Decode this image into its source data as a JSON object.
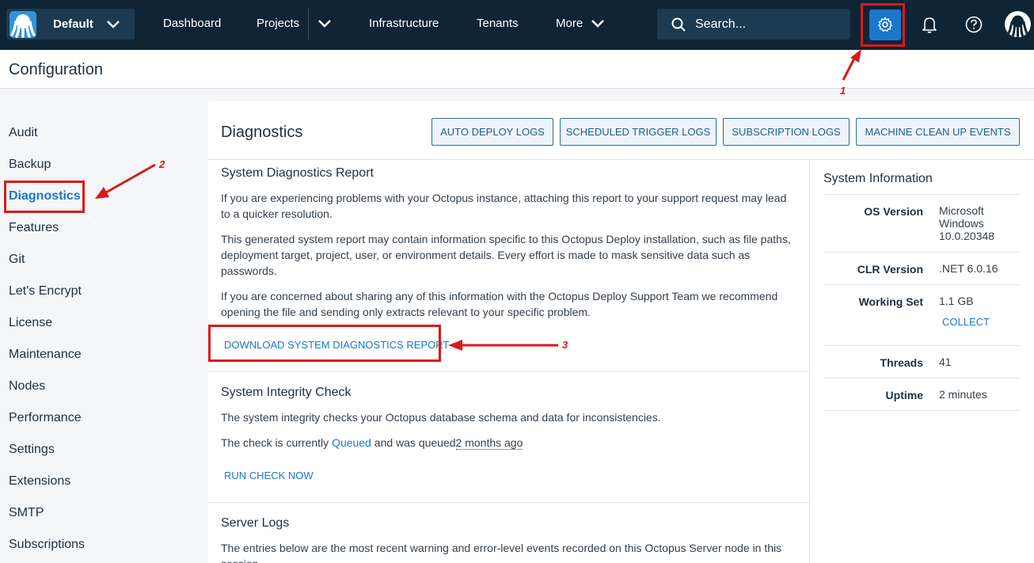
{
  "topnav": {
    "space_name": "Default",
    "links": [
      "Dashboard",
      "Projects",
      "Infrastructure",
      "Tenants",
      "More"
    ],
    "search_placeholder": "Search..."
  },
  "page": {
    "title": "Configuration"
  },
  "sidebar": {
    "items": [
      "Audit",
      "Backup",
      "Diagnostics",
      "Features",
      "Git",
      "Let's Encrypt",
      "License",
      "Maintenance",
      "Nodes",
      "Performance",
      "Settings",
      "Extensions",
      "SMTP",
      "Subscriptions"
    ],
    "active": "Diagnostics"
  },
  "main": {
    "title": "Diagnostics",
    "toolbar": [
      "AUTO DEPLOY LOGS",
      "SCHEDULED TRIGGER LOGS",
      "SUBSCRIPTION LOGS",
      "MACHINE CLEAN UP EVENTS"
    ],
    "report": {
      "title": "System Diagnostics Report",
      "p1": "If you are experiencing problems with your Octopus instance, attaching this report to your support request may lead to a quicker resolution.",
      "p2": "This generated system report may contain information specific to this Octopus Deploy installation, such as file paths, deployment target, project, user, or environment details. Every effort is made to mask sensitive data such as passwords.",
      "p3": "If you are concerned about sharing any of this information with the Octopus Deploy Support Team we recommend opening the file and sending only extracts relevant to your specific problem.",
      "download_label": "DOWNLOAD SYSTEM DIAGNOSTICS REPORT"
    },
    "integrity": {
      "title": "System Integrity Check",
      "p1": "The system integrity checks your Octopus database schema and data for inconsistencies.",
      "status_prefix": "The check is currently ",
      "status": "Queued",
      "status_mid": " and was queued",
      "status_time": "2 months ago",
      "run_label": "RUN CHECK NOW"
    },
    "logs": {
      "title": "Server Logs",
      "p1": "The entries below are the most recent warning and error-level events recorded on this Octopus Server node in this session."
    }
  },
  "system_info": {
    "title": "System Information",
    "os_label": "OS Version",
    "os_value_lines": [
      "Microsoft",
      "Windows",
      "10.0.20348"
    ],
    "clr_label": "CLR Version",
    "clr_value": ".NET 6.0.16",
    "ws_label": "Working Set",
    "ws_value": "1.1 GB",
    "collect_label": "COLLECT",
    "threads_label": "Threads",
    "threads_value": "41",
    "uptime_label": "Uptime",
    "uptime_value": "2 minutes"
  },
  "annotations": [
    "1",
    "2",
    "3"
  ],
  "colors": {
    "nav_bg": "#0f2535",
    "accent": "#1a77ca",
    "annotation_red": "#d91a1a"
  }
}
